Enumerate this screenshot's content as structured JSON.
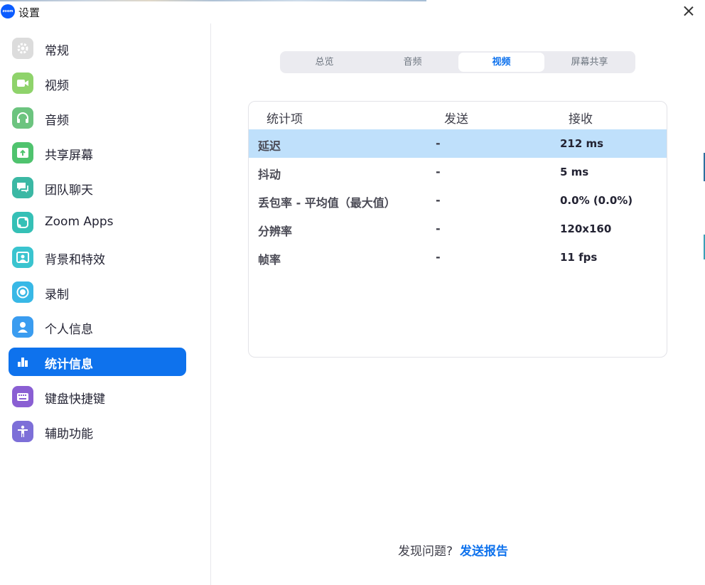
{
  "window": {
    "title": "设置",
    "logo_text": "zoom"
  },
  "sidebar": {
    "items": [
      {
        "label": "常规",
        "icon": "gear-icon",
        "color": "#dcdcdc"
      },
      {
        "label": "视频",
        "icon": "video-camera-icon",
        "color": "#8fd36b"
      },
      {
        "label": "音频",
        "icon": "headphones-icon",
        "color": "#6cc47f"
      },
      {
        "label": "共享屏幕",
        "icon": "share-screen-icon",
        "color": "#4fc36e"
      },
      {
        "label": "团队聊天",
        "icon": "chat-icon",
        "color": "#3bb8a4"
      },
      {
        "label": "Zoom Apps",
        "icon": "apps-icon",
        "color": "#35c0b6"
      },
      {
        "label": "背景和特效",
        "icon": "background-icon",
        "color": "#3ac4cf"
      },
      {
        "label": "录制",
        "icon": "record-icon",
        "color": "#38b8e6"
      },
      {
        "label": "个人信息",
        "icon": "profile-icon",
        "color": "#3a9cf0"
      },
      {
        "label": "统计信息",
        "icon": "statistics-icon",
        "color": "#0e72ed",
        "active": true
      },
      {
        "label": "键盘快捷键",
        "icon": "keyboard-icon",
        "color": "#8a5fd3"
      },
      {
        "label": "辅助功能",
        "icon": "accessibility-icon",
        "color": "#7d6fd8"
      }
    ]
  },
  "tabs": [
    {
      "label": "总览"
    },
    {
      "label": "音频"
    },
    {
      "label": "视频",
      "active": true
    },
    {
      "label": "屏幕共享"
    }
  ],
  "stats": {
    "headers": {
      "item": "统计项",
      "send": "发送",
      "receive": "接收"
    },
    "rows": [
      {
        "name": "延迟",
        "send": "-",
        "receive": "212 ms",
        "selected": true
      },
      {
        "name": "抖动",
        "send": "-",
        "receive": "5 ms"
      },
      {
        "name": "丢包率 - 平均值（最大值）",
        "send": "-",
        "receive": "0.0% (0.0%)"
      },
      {
        "name": "分辨率",
        "send": "-",
        "receive": "120x160"
      },
      {
        "name": "帧率",
        "send": "-",
        "receive": "11 fps"
      }
    ]
  },
  "footer": {
    "question": "发现问题?",
    "link": "发送报告"
  },
  "colors": {
    "accent": "#0e72ed",
    "selected_row": "#bfe0fb"
  }
}
